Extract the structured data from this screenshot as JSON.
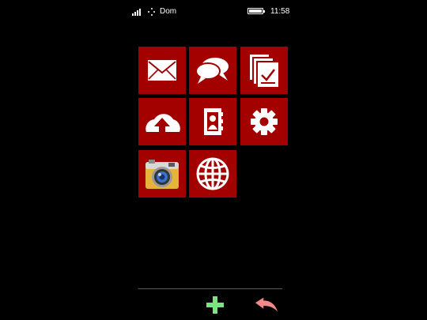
{
  "status_bar": {
    "network_name": "Dom",
    "time": "11:58",
    "signal_bars": 4,
    "battery_level": 1.0,
    "icons": [
      "signal-icon",
      "wifi-icon",
      "battery-icon"
    ]
  },
  "tiles": [
    {
      "icon": "mail-icon"
    },
    {
      "icon": "chat-icon"
    },
    {
      "icon": "tasks-icon"
    },
    {
      "icon": "cloud-upload-icon"
    },
    {
      "icon": "contacts-icon"
    },
    {
      "icon": "gear-icon"
    },
    {
      "icon": "camera-icon"
    },
    {
      "icon": "globe-icon"
    }
  ],
  "bottom_bar": {
    "buttons": [
      {
        "icon": "plus-icon"
      },
      {
        "icon": "back-arrow-icon"
      }
    ]
  },
  "colors": {
    "background": "#000000",
    "tile": "#a30000",
    "plus": "#7fe07f",
    "back": "#f08a8a",
    "divider": "#5a5a5a"
  }
}
